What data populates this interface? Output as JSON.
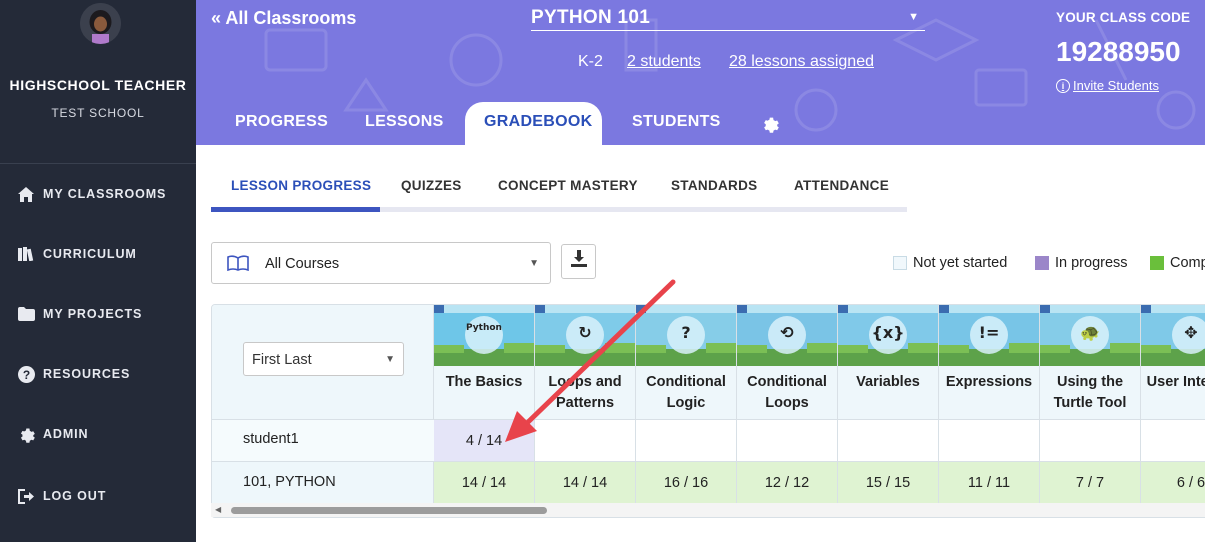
{
  "sidebar": {
    "teacher_name": "HIGHSCHOOL TEACHER",
    "school_name": "TEST SCHOOL",
    "items": [
      {
        "label": "MY CLASSROOMS",
        "icon": "home-icon"
      },
      {
        "label": "CURRICULUM",
        "icon": "books-icon"
      },
      {
        "label": "MY PROJECTS",
        "icon": "folder-icon"
      },
      {
        "label": "RESOURCES",
        "icon": "question-icon"
      },
      {
        "label": "ADMIN",
        "icon": "gear-icon"
      },
      {
        "label": "LOG OUT",
        "icon": "logout-icon"
      }
    ]
  },
  "header": {
    "back_label": "« All Classrooms",
    "class_name": "PYTHON 101",
    "grade": "K-2",
    "students_link": "2 students",
    "lessons_link": "28 lessons assigned",
    "code_label": "YOUR CLASS CODE",
    "code_value": "19288950",
    "invite_label": "Invite Students",
    "tabs": [
      {
        "label": "PROGRESS"
      },
      {
        "label": "LESSONS"
      },
      {
        "label": "GRADEBOOK",
        "active": true
      },
      {
        "label": "STUDENTS"
      }
    ]
  },
  "subtabs": [
    {
      "label": "LESSON PROGRESS",
      "active": true
    },
    {
      "label": "QUIZZES"
    },
    {
      "label": "CONCEPT MASTERY"
    },
    {
      "label": "STANDARDS"
    },
    {
      "label": "ATTENDANCE"
    }
  ],
  "filters": {
    "course_select": "All Courses",
    "sort_select": "First Last"
  },
  "legend": [
    {
      "label": "Not yet started",
      "color": "#f1f8fc"
    },
    {
      "label": "In progress",
      "color": "#9b86c9"
    },
    {
      "label": "Comp",
      "color": "#6abf3b"
    }
  ],
  "gradebook": {
    "lessons": [
      {
        "name": "The Basics",
        "glyph": "Python"
      },
      {
        "name": "Loops and Patterns",
        "glyph": "↻"
      },
      {
        "name": "Conditional Logic",
        "glyph": "?"
      },
      {
        "name": "Conditional Loops",
        "glyph": "⟲"
      },
      {
        "name": "Variables",
        "glyph": "{x}"
      },
      {
        "name": "Expressions",
        "glyph": "!="
      },
      {
        "name": "Using the Turtle Tool",
        "glyph": "🐢"
      },
      {
        "name": "User Interact",
        "glyph": "✥"
      }
    ],
    "rows": [
      {
        "label": "student1",
        "cells": [
          "4 / 14",
          "",
          "",
          "",
          "",
          "",
          "",
          ""
        ]
      },
      {
        "label": "101, PYTHON",
        "cells": [
          "14 / 14",
          "14 / 14",
          "16 / 16",
          "12 / 12",
          "15 / 15",
          "11 / 11",
          "7 / 7",
          "6 / 6"
        ]
      }
    ]
  }
}
